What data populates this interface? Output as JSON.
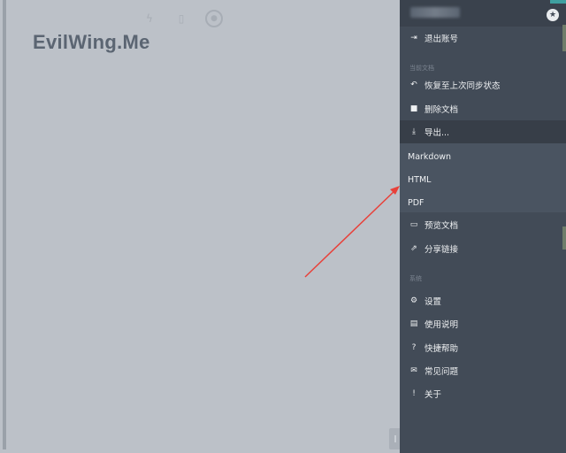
{
  "editor": {
    "title": "EvilWing.Me",
    "toolbar_icons": [
      "lightning-icon",
      "document-icon",
      "user-circle-icon"
    ]
  },
  "sidebar": {
    "logout": "退出账号",
    "section_doc": "当前文档",
    "restore": "恢复至上次同步状态",
    "delete": "删除文档",
    "export": "导出...",
    "export_options": [
      "Markdown",
      "HTML",
      "PDF"
    ],
    "preview": "预览文档",
    "share": "分享链接",
    "section_system": "系统",
    "settings": "设置",
    "instructions": "使用说明",
    "shortcuts": "快捷帮助",
    "faq": "常见问题",
    "about": "关于"
  },
  "colors": {
    "editor_bg": "#bcc1c8",
    "sidebar_bg": "#424b57",
    "export_header_bg": "#373e48",
    "arrow": "#e8413a"
  }
}
